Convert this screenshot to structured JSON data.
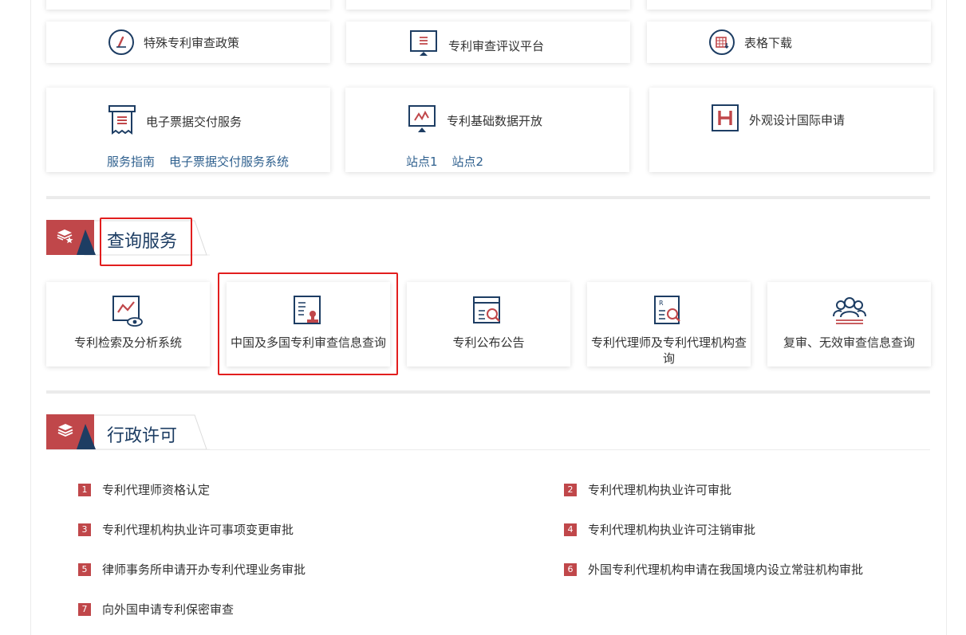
{
  "services_top": {
    "row1": [
      {
        "label": "特殊专利审查政策",
        "icon": "pen-circle-icon"
      },
      {
        "label": "专利审查评议平台",
        "icon": "monitor-doc-icon"
      },
      {
        "label": "表格下载",
        "icon": "table-download-icon"
      }
    ],
    "row2": [
      {
        "label": "电子票据交付服务",
        "icon": "receipt-icon",
        "links": [
          "服务指南",
          "电子票据交付服务系统"
        ]
      },
      {
        "label": "专利基础数据开放",
        "icon": "monitor-chart-icon",
        "links": [
          "站点1",
          "站点2"
        ]
      },
      {
        "label": "外观设计国际申请",
        "icon": "h-box-icon"
      }
    ]
  },
  "query_section": {
    "title": "查询服务",
    "cards": [
      {
        "label": "专利检索及分析系统",
        "icon": "chart-eye-icon"
      },
      {
        "label": "中国及多国专利审查信息查询",
        "icon": "doc-stamp-icon"
      },
      {
        "label": "专利公布公告",
        "icon": "doc-search-icon"
      },
      {
        "label": "专利代理师及专利代理机构查询",
        "icon": "agent-search-icon"
      },
      {
        "label": "复审、无效审查信息查询",
        "icon": "people-group-icon"
      }
    ]
  },
  "admin_section": {
    "title": "行政许可",
    "items": [
      {
        "num": "1",
        "label": "专利代理师资格认定"
      },
      {
        "num": "2",
        "label": "专利代理机构执业许可审批"
      },
      {
        "num": "3",
        "label": "专利代理机构执业许可事项变更审批"
      },
      {
        "num": "4",
        "label": "专利代理机构执业许可注销审批"
      },
      {
        "num": "5",
        "label": "律师事务所申请开办专利代理业务审批"
      },
      {
        "num": "6",
        "label": "外国专利代理机构申请在我国境内设立常驻机构审批"
      },
      {
        "num": "7",
        "label": "向外国申请专利保密审查"
      }
    ]
  },
  "colors": {
    "navy": "#1d3d63",
    "red": "#c0474a",
    "link": "#30618f",
    "highlight": "#e21e1e"
  }
}
